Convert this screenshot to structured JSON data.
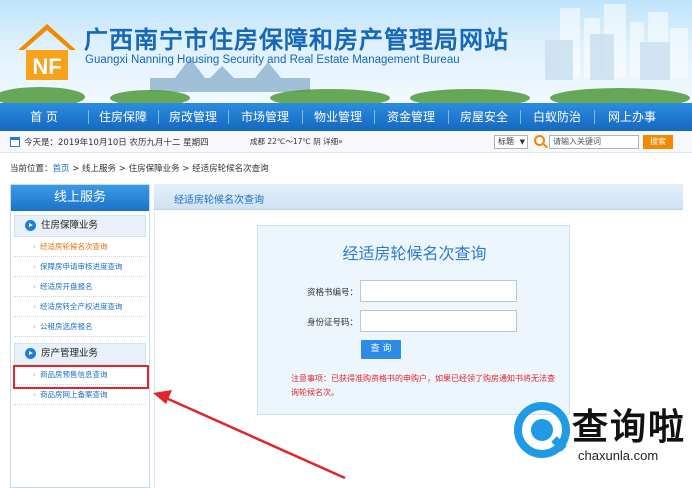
{
  "header": {
    "title": "广西南宁市住房保障和房产管理局网站",
    "subtitle": "Guangxi Nanning Housing Security and Real Estate  Management Bureau"
  },
  "nav": [
    "首 页",
    "住房保障",
    "房改管理",
    "市场管理",
    "物业管理",
    "资金管理",
    "房屋安全",
    "白蚁防治",
    "网上办事"
  ],
  "infobar": {
    "date": "今天是：2019年10月10日  农历九月十二  星期四",
    "weather": "成都  22℃～17℃  阴  详细»",
    "select_value": "标题",
    "search_placeholder": "请输入关键词",
    "search_button": "搜索"
  },
  "breadcrumb": {
    "prefix": "当前位置：",
    "home": "首页",
    "rest": " > 线上服务 > 住房保障业务 > 经适房轮候名次查询"
  },
  "sidebar": {
    "title": "线上服务",
    "group1": "住房保障业务",
    "group1_items": [
      "经适房轮候名次查询",
      "保障房申请审核进度查询",
      "经适房开盘报名",
      "经适房转全产权进度查询",
      "公租房选房报名"
    ],
    "group2": "房产管理业务",
    "group2_items": [
      "商品房预售信息查询",
      "商品房网上备案查询"
    ]
  },
  "main": {
    "header": "经适房轮候名次查询",
    "form_title": "经适房轮候名次查询",
    "field1_label": "资格书编号：",
    "field1_value": "",
    "field2_label": "身份证号码：",
    "field2_value": "",
    "query_button": "查 询",
    "notice": "注意事项：已获得准购资格书的申购户，如果已经领了购房通知书将无法查询轮候名次。"
  },
  "watermark": {
    "text": "查询啦",
    "url": "chaxunla.com"
  },
  "colors": {
    "nav_blue": "#1667c0",
    "link_blue": "#1a6fc4",
    "orange": "#f28a00",
    "red": "#e0262b"
  }
}
